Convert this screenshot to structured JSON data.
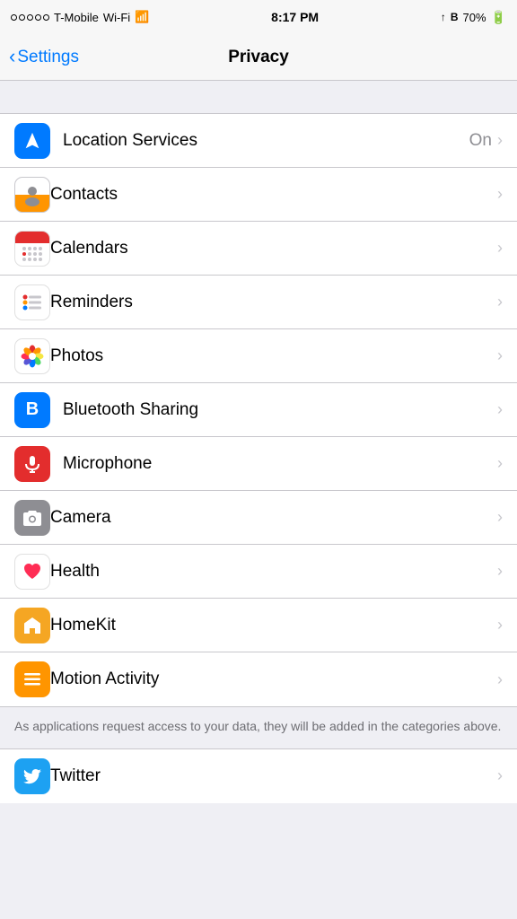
{
  "status": {
    "carrier": "T-Mobile",
    "wifi": "Wi-Fi",
    "time": "8:17 PM",
    "battery": "70%",
    "signal_dots": [
      false,
      false,
      false,
      false,
      false
    ]
  },
  "nav": {
    "back_label": "Settings",
    "title": "Privacy"
  },
  "items": [
    {
      "id": "location-services",
      "label": "Location Services",
      "value": "On",
      "icon": "location",
      "interactable": true
    },
    {
      "id": "contacts",
      "label": "Contacts",
      "value": "",
      "icon": "contacts",
      "interactable": true
    },
    {
      "id": "calendars",
      "label": "Calendars",
      "value": "",
      "icon": "calendars",
      "interactable": true
    },
    {
      "id": "reminders",
      "label": "Reminders",
      "value": "",
      "icon": "reminders",
      "interactable": true
    },
    {
      "id": "photos",
      "label": "Photos",
      "value": "",
      "icon": "photos",
      "interactable": true
    },
    {
      "id": "bluetooth-sharing",
      "label": "Bluetooth Sharing",
      "value": "",
      "icon": "bluetooth",
      "interactable": true
    },
    {
      "id": "microphone",
      "label": "Microphone",
      "value": "",
      "icon": "microphone",
      "interactable": true
    },
    {
      "id": "camera",
      "label": "Camera",
      "value": "",
      "icon": "camera",
      "interactable": true
    },
    {
      "id": "health",
      "label": "Health",
      "value": "",
      "icon": "health",
      "interactable": true
    },
    {
      "id": "homekit",
      "label": "HomeKit",
      "value": "",
      "icon": "homekit",
      "interactable": true
    },
    {
      "id": "motion-activity",
      "label": "Motion Activity",
      "value": "",
      "icon": "motion",
      "interactable": true
    }
  ],
  "footer": {
    "note": "As applications request access to your data, they will be added in the categories above."
  },
  "section2": {
    "items": [
      {
        "id": "twitter",
        "label": "Twitter",
        "icon": "twitter"
      }
    ]
  },
  "chevron": "›",
  "back_chevron": "‹"
}
